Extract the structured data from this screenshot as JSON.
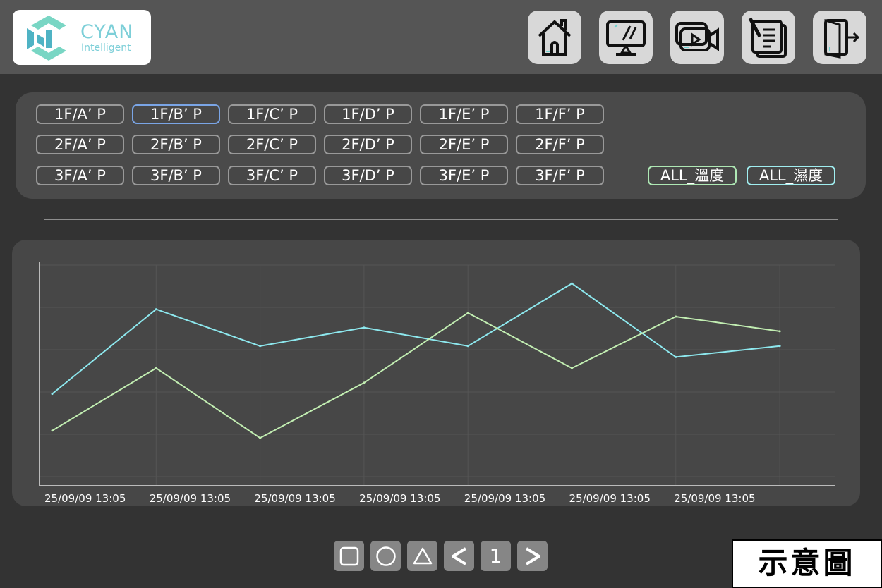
{
  "header": {
    "logo": {
      "name": "CYAN",
      "sub": "Intelligent"
    },
    "nav_icons": [
      "home-icon",
      "monitor-icon",
      "video-camera-icon",
      "document-icon",
      "exit-icon"
    ]
  },
  "sensors": {
    "rows": [
      [
        "1F/A’ P",
        "1F/B’ P",
        "1F/C’ P",
        "1F/D’ P",
        "1F/E’ P",
        "1F/F’ P"
      ],
      [
        "2F/A’ P",
        "2F/B’ P",
        "2F/C’ P",
        "2F/D’ P",
        "2F/E’ P",
        "2F/F’ P"
      ],
      [
        "3F/A’ P",
        "3F/B’ P",
        "3F/C’ P",
        "3F/D’ P",
        "3F/E’ P",
        "3F/F’ P"
      ]
    ],
    "selected": "1F/B’ P",
    "all_temp": "ALL_溫度",
    "all_humidity": "ALL_濕度"
  },
  "chart_data": {
    "type": "line",
    "categories": [
      "25/09/09 13:05",
      "25/09/09 13:05",
      "25/09/09 13:05",
      "25/09/09 13:05",
      "25/09/09 13:05",
      "25/09/09 13:05",
      "25/09/09 13:05",
      "25/09/09 13:05"
    ],
    "series": [
      {
        "color": "#8de8ee",
        "values": [
          2.1,
          4.4,
          3.4,
          3.9,
          3.4,
          5.1,
          3.1,
          3.4
        ]
      },
      {
        "color": "#c2eeb2",
        "values": [
          1.1,
          2.8,
          0.9,
          2.4,
          4.3,
          2.8,
          4.2,
          3.8
        ]
      }
    ],
    "ylim": [
      -0.4,
      5.6
    ],
    "grid": true
  },
  "pager": {
    "square": "□",
    "circle": "○",
    "triangle": "△",
    "prev": "<",
    "page": "1",
    "next": ">"
  },
  "stamp": "示意圖"
}
